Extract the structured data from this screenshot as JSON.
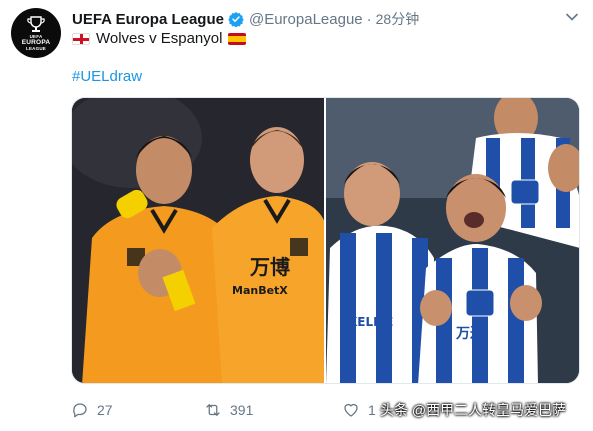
{
  "account": {
    "avatar_line1": "UEFA",
    "avatar_line2": "EUROPA",
    "avatar_line3": "LEAGUE",
    "name": "UEFA Europa League",
    "handle": "@EuropaLeague",
    "separator": "·",
    "time": "28分钟"
  },
  "tweet": {
    "match_text": "Wolves v Espanyol",
    "hashtag": "#UELdraw",
    "flags": [
      "england-flag",
      "spain-flag"
    ]
  },
  "media": {
    "left_photo": {
      "shirt_text": "万博",
      "shirt_sponsor": "ManBetX"
    },
    "right_photo": {
      "shirt_text": "万达",
      "shirt_sponsor": "KELME"
    }
  },
  "actions": {
    "replies": "27",
    "retweets": "391",
    "likes": "1"
  },
  "watermark": "头条 @西甲二人转皇马爱巴萨",
  "colors": {
    "link": "#1b95e0",
    "muted": "#657786",
    "verified": "#1da1f2",
    "wolves_orange": "#f39a1f",
    "espanyol_blue": "#1f4fa8"
  }
}
